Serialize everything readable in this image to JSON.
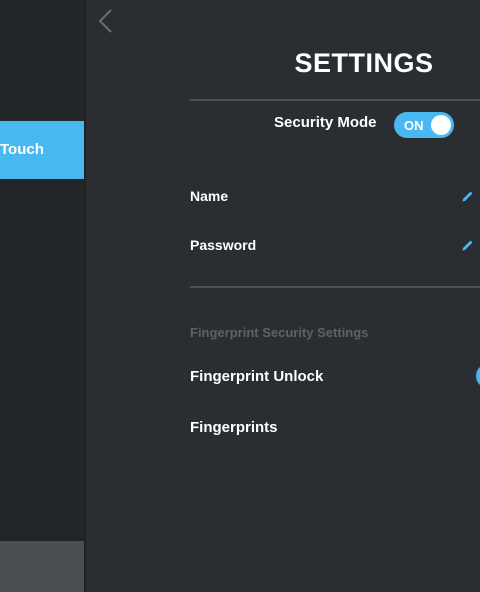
{
  "colors": {
    "accent": "#49b8f0",
    "background": "#2a2d31",
    "sidebar": "#232629",
    "section_header": "#5d6268"
  },
  "sidebar": {
    "active_item_label": "Touch"
  },
  "header": {
    "title": "SETTINGS",
    "back_icon": "chevron-left-icon"
  },
  "security": {
    "mode_label": "Security Mode",
    "toggle_state": "ON"
  },
  "fields": {
    "name_label": "Name",
    "password_label": "Password",
    "edit_icon": "pencil-icon"
  },
  "fingerprint": {
    "section_header": "Fingerprint Security Settings",
    "unlock_label": "Fingerprint Unlock",
    "fingerprints_label": "Fingerprints"
  }
}
